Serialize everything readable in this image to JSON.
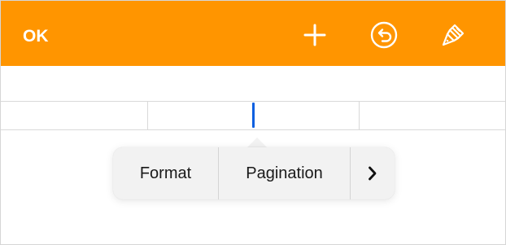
{
  "toolbar": {
    "background": "#ff9500",
    "ok_label": "OK",
    "icons": [
      "plus-icon",
      "undo-icon",
      "paintbrush-icon"
    ]
  },
  "table": {
    "cursor_color": "#0a5fe0"
  },
  "context_menu": {
    "items": [
      {
        "label": "Format"
      },
      {
        "label": "Pagination"
      },
      {
        "label": "›",
        "icon": "chevron-right-icon"
      }
    ]
  }
}
